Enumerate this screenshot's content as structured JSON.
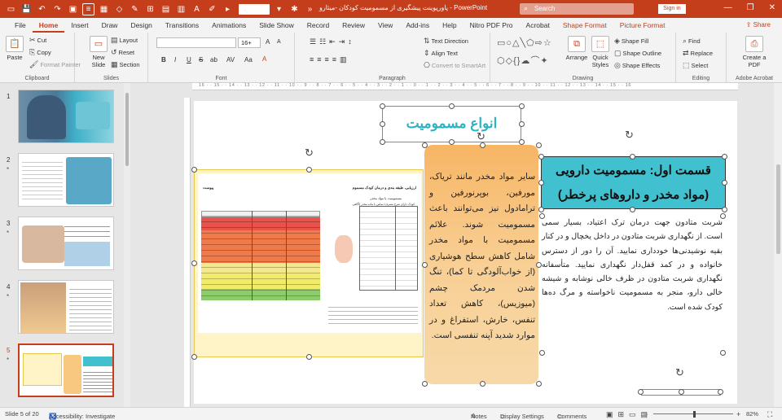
{
  "titlebar": {
    "window_title": "پاورپوینت پیشگیری از مسمومیت کودکان -میثارو",
    "app_name": "PowerPoint",
    "search_placeholder": "Search",
    "signin_label": "Sign in",
    "minimize": "—",
    "restore": "❐",
    "close": "✕"
  },
  "tabs": [
    "File",
    "Home",
    "Insert",
    "Draw",
    "Design",
    "Transitions",
    "Animations",
    "Slide Show",
    "Record",
    "Review",
    "View",
    "Add-ins",
    "Help",
    "Nitro PDF Pro",
    "Acrobat",
    "Shape Format",
    "Picture Format"
  ],
  "share_label": "Share",
  "ribbon": {
    "clipboard": {
      "label": "Clipboard",
      "paste": "Paste",
      "cut": "Cut",
      "copy": "Copy",
      "format_painter": "Format Painter"
    },
    "slides": {
      "label": "Slides",
      "new_slide": "New Slide",
      "layout": "Layout",
      "reset": "Reset",
      "section": "Section"
    },
    "font": {
      "label": "Font",
      "font_size": "16+",
      "bold": "B",
      "italic": "I",
      "underline": "U",
      "strike": "S",
      "shadow": "ab",
      "spacing": "AV",
      "case": "Aa",
      "grow": "A",
      "shrink": "A"
    },
    "paragraph": {
      "label": "Paragraph",
      "text_direction": "Text Direction",
      "align_text": "Align Text",
      "convert_smartart": "Convert to SmartArt"
    },
    "drawing": {
      "label": "Drawing",
      "arrange": "Arrange",
      "quick_styles": "Quick Styles",
      "shape_fill": "Shape Fill",
      "shape_outline": "Shape Outline",
      "shape_effects": "Shape Effects"
    },
    "editing": {
      "label": "Editing",
      "find": "Find",
      "replace": "Replace",
      "select": "Select"
    },
    "adobe": {
      "label": "Adobe Acrobat",
      "create_pdf": "Create a PDF"
    }
  },
  "thumbnails": [
    {
      "num": "1",
      "star": ""
    },
    {
      "num": "2",
      "star": "*"
    },
    {
      "num": "3",
      "star": "*"
    },
    {
      "num": "4",
      "star": "*"
    },
    {
      "num": "5",
      "star": "*",
      "selected": true
    }
  ],
  "ruler_text": "16 · · 15 · · 14 · · 13 · · 12 · · 11 · · 10 · · 9 · · 8 · · 7 · · 6 · · 5 · · 4 · · 3 · · 2 · · 1 · · 0 · · 1 · · 2 · · 3 · · 4 · · 5 · · 6 · · 7 · · 8 · · 9 · · 10 · · 11 · · 12 · · 13 · · 14 · · 15 · · 16",
  "slide": {
    "title": "انواع مسمومیت",
    "heading_line1": "قسمت اول: مسمومیت دارویی",
    "heading_line2": "(مواد مخدر و داروهای پرخطر)",
    "orange_text": "سایر مواد مخدر مانند تریاک، مورفین، بوپرنورفین و ترامادول نیز می‌توانند باعث مسمومیت شوند. علائم مسمومیت با مواد مخدر شامل کاهش سطح هوشیاری (از خواب‌آلودگی تا کما)، تنگ شدن مردمک چشم (میوزیس)، کاهش تعداد تنفس، خارش، استفراغ و در موارد شدید آپنه تنفسی است.",
    "body_text": "شربت متادون جهت درمان ترک اعتیاد، بسیار سمی است. از نگهداری شربت متادون در داخل یخچال و در کنار بقیه نوشیدنی‌ها خودداری نمایید. آن را دور از دسترس خانواده و در کمد قفل‌دار نگهداری نمایید. متأسفانه نگهداری شربت متادون در ظرف خالی نوشابه و شیشه خالی دارو، منجر به مسمومیت ناخواسته و مرگ ده‌ها کودک شده است.",
    "table_title": "ارزیابی، طبقه بندی و درمان کودک مسموم",
    "table_left": "پیوست",
    "table_sub": "مسمومیت با مواد مخدر",
    "table_note": "کودک دارای شرح مصرف/ تماس با ماده مخدر (آگاهی کودک)"
  },
  "status": {
    "slide": "Slide 5 of 20",
    "accessibility": "Accessibility: Investigate",
    "notes": "Notes",
    "display": "Display Settings",
    "comments": "Comments",
    "zoom": "82%"
  }
}
